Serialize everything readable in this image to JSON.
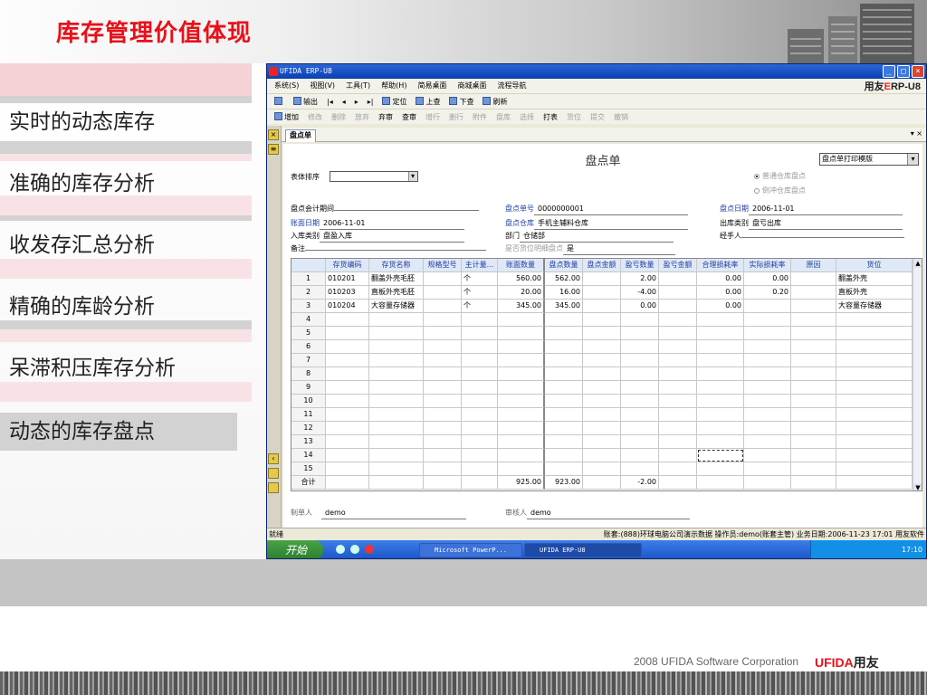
{
  "slide": {
    "title": "库存管理价值体现",
    "menu": [
      "实时的动态库存",
      "准确的库存分析",
      "收发存汇总分析",
      "精确的库龄分析",
      "呆滞积压库存分析",
      "动态的库存盘点"
    ],
    "footer_text": "2008 UFIDA Software Corporation",
    "footer_brand": "UFIDA",
    "footer_brand_cn": "用友"
  },
  "window": {
    "title": "UFIDA ERP-U8",
    "brand_prefix": "用友",
    "brand_e": "E",
    "brand_rest": "RP-U8",
    "menus": [
      "系统(S)",
      "视图(V)",
      "工具(T)",
      "帮助(H)",
      "简易桌面",
      "商城桌面",
      "流程导航"
    ],
    "toolbar1": [
      "输出",
      "定位",
      "上查",
      "下查",
      "刷新"
    ],
    "toolbar2": [
      "增加",
      "修改",
      "删除",
      "放弃",
      "弃审",
      "查审",
      "增行",
      "删行",
      "附件",
      "盘库",
      "选择",
      "打表",
      "货位",
      "提交",
      "撤销"
    ],
    "doc_tab": "盘点单",
    "doc_tab_ctrl": "▾ ×"
  },
  "form": {
    "title": "盘点单",
    "print_template": "盘点单打印模版",
    "sort_label": "表体排序",
    "radio1": "普通仓库盘点",
    "radio2": "倒冲仓库盘点",
    "fields": {
      "period_label": "盘点会计期间",
      "number_label": "盘点单号",
      "number": "0000000001",
      "date_label": "盘点日期",
      "date": "2006-11-01",
      "book_date_label": "账面日期",
      "book_date": "2006-11-01",
      "warehouse_label": "盘点仓库",
      "warehouse": "手机主辅料仓库",
      "out_type_label": "出库类别",
      "out_type": "盘亏出库",
      "in_type_label": "入库类别",
      "in_type": "盘盈入库",
      "dept_label": "部门",
      "dept": "仓储部",
      "handler_label": "经手人",
      "remark_label": "备注",
      "detail_label": "是否货位明细盘点",
      "detail": "是"
    },
    "maker_label": "制单人",
    "maker": "demo",
    "auditor_label": "审核人",
    "auditor": "demo"
  },
  "grid": {
    "headers": [
      "",
      "存货编码",
      "存货名称",
      "规格型号",
      "主计量...",
      "账面数量",
      "盘点数量",
      "盘点金额",
      "盈亏数量",
      "盈亏金额",
      "合理损耗率",
      "实际损耗率",
      "原因",
      "货位"
    ],
    "rows": [
      [
        "1",
        "010201",
        "翻盖外壳毛胚",
        "",
        "个",
        "560.00",
        "562.00",
        "",
        "2.00",
        "",
        "0.00",
        "0.00",
        "",
        "翻盖外壳"
      ],
      [
        "2",
        "010203",
        "直板外壳毛胚",
        "",
        "个",
        "20.00",
        "16.00",
        "",
        "-4.00",
        "",
        "0.00",
        "0.20",
        "",
        "直板外壳"
      ],
      [
        "3",
        "010204",
        "大容量存储器",
        "",
        "个",
        "345.00",
        "345.00",
        "",
        "0.00",
        "",
        "0.00",
        "",
        "",
        "大容量存储器"
      ],
      [
        "4"
      ],
      [
        "5"
      ],
      [
        "6"
      ],
      [
        "7"
      ],
      [
        "8"
      ],
      [
        "9"
      ],
      [
        "10"
      ],
      [
        "11"
      ],
      [
        "12"
      ],
      [
        "13"
      ],
      [
        "14"
      ],
      [
        "15"
      ]
    ],
    "total": [
      "合计",
      "",
      "",
      "",
      "",
      "925.00",
      "923.00",
      "",
      "-2.00",
      "",
      "",
      "",
      "",
      ""
    ]
  },
  "status": {
    "left": "就绪",
    "right": "账套:(888)环球电脑公司演示数据  操作员:demo(账套主管)  业务日期:2006-11-23 17:01 用友软件"
  },
  "taskbar": {
    "start": "开始",
    "tasks": [
      "Microsoft PowerP...",
      "UFIDA ERP-U8"
    ],
    "clock": "17:10"
  }
}
